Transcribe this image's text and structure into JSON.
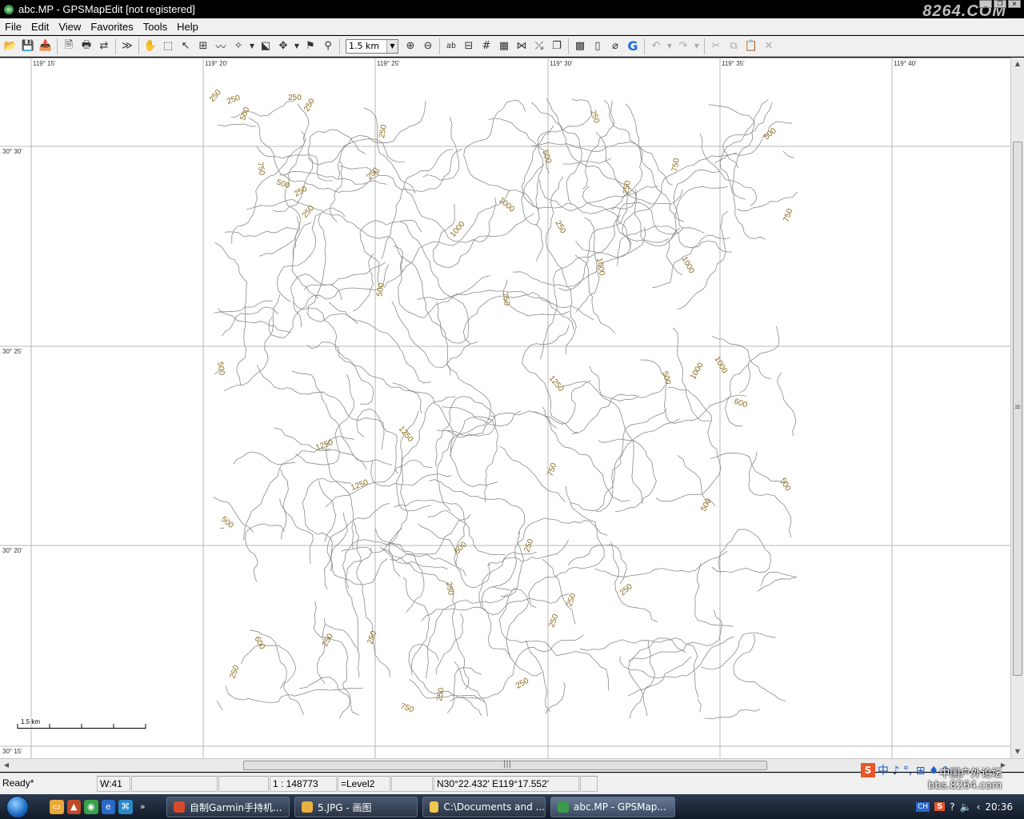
{
  "window": {
    "title": "abc.MP - GPSMapEdit [not registered]",
    "watermark": "8264.COM"
  },
  "menu": [
    "File",
    "Edit",
    "View",
    "Favorites",
    "Tools",
    "Help"
  ],
  "toolbar": {
    "scale_value": "1.5 km",
    "label_ab": "ab"
  },
  "map": {
    "longitudes": [
      "119° 15'",
      "119° 20'",
      "119° 25'",
      "119° 30'",
      "119° 35'",
      "119° 40'"
    ],
    "latitudes": [
      "30° 30'",
      "30° 25'",
      "30° 20'",
      "30° 15'"
    ],
    "scalebar_label": "1.5 km",
    "contour_labels": [
      "250",
      "250",
      "250",
      "250",
      "500",
      "750",
      "500",
      "250",
      "250",
      "250",
      "250",
      "250",
      "500",
      "750",
      "500",
      "1000",
      "250",
      "750",
      "250",
      "1000",
      "1000",
      "1000",
      "750",
      "500",
      "1000",
      "1000",
      "500",
      "1250",
      "1250",
      "1250",
      "1250",
      "750",
      "600",
      "500",
      "500",
      "500",
      "500",
      "500",
      "250",
      "250",
      "250",
      "250",
      "250",
      "250",
      "250",
      "250",
      "250",
      "250",
      "750",
      "600"
    ]
  },
  "status": {
    "ready": "Ready*",
    "w": "W:41",
    "scale": "1 : 148773",
    "level": "=Level2",
    "coords": "N30°22.432' E119°17.552'"
  },
  "ime": {
    "s": "S",
    "text": "中 ♪ °, ⊞ ♦ ✎",
    "watermark_top": "中国户外论坛",
    "watermark_bottom": "bbs.8264.com"
  },
  "taskbar": {
    "tasks": [
      {
        "label": "自制Garmin手持机...",
        "color": "#d94a2a"
      },
      {
        "label": "5.JPG - 画图",
        "color": "#e8b040"
      },
      {
        "label": "C:\\Documents and ...",
        "color": "#f0c850"
      },
      {
        "label": "abc.MP - GPSMap...",
        "color": "#3a9a4a"
      }
    ],
    "tray_ch": "CH",
    "tray_s": "S",
    "clock": "20:36"
  }
}
